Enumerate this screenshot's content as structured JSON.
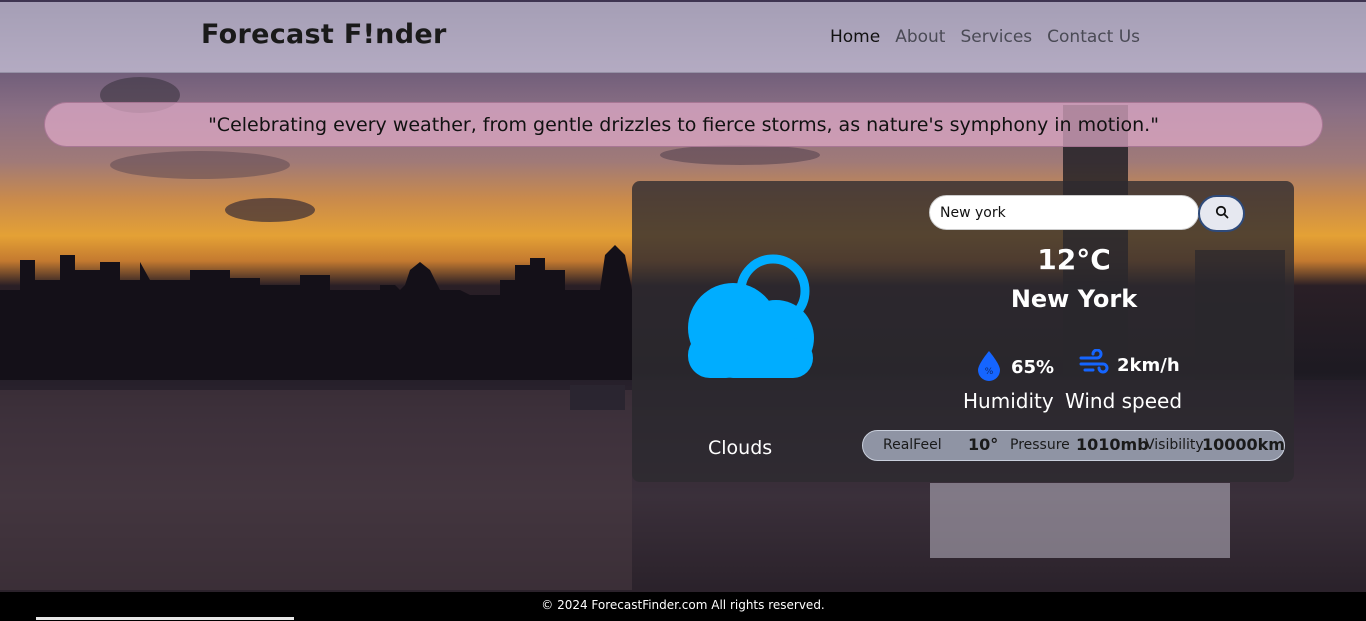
{
  "header": {
    "brand": "Forecast F!nder",
    "nav": [
      {
        "label": "Home"
      },
      {
        "label": "About"
      },
      {
        "label": "Services"
      },
      {
        "label": "Contact Us"
      }
    ]
  },
  "quote": "\"Celebrating every weather, from gentle drizzles to fierce storms, as nature's symphony in motion.\"",
  "weather": {
    "search_value": "New york",
    "temperature": "12°C",
    "city": "New York",
    "condition": "Clouds",
    "humidity_value": "65%",
    "humidity_label": "Humidity",
    "wind_value": "2km/h",
    "wind_label": "Wind speed",
    "realfeel_label": "RealFeel",
    "realfeel_value": "10°",
    "pressure_label": "Pressure",
    "pressure_value": "1010mb",
    "visibility_label": "Visibility",
    "visibility_value": "10000km"
  },
  "footer": {
    "text": "© 2024 ForecastFinder.com All rights reserved."
  },
  "colors": {
    "accent": "#00adff",
    "icon_blue": "#1565ff"
  }
}
